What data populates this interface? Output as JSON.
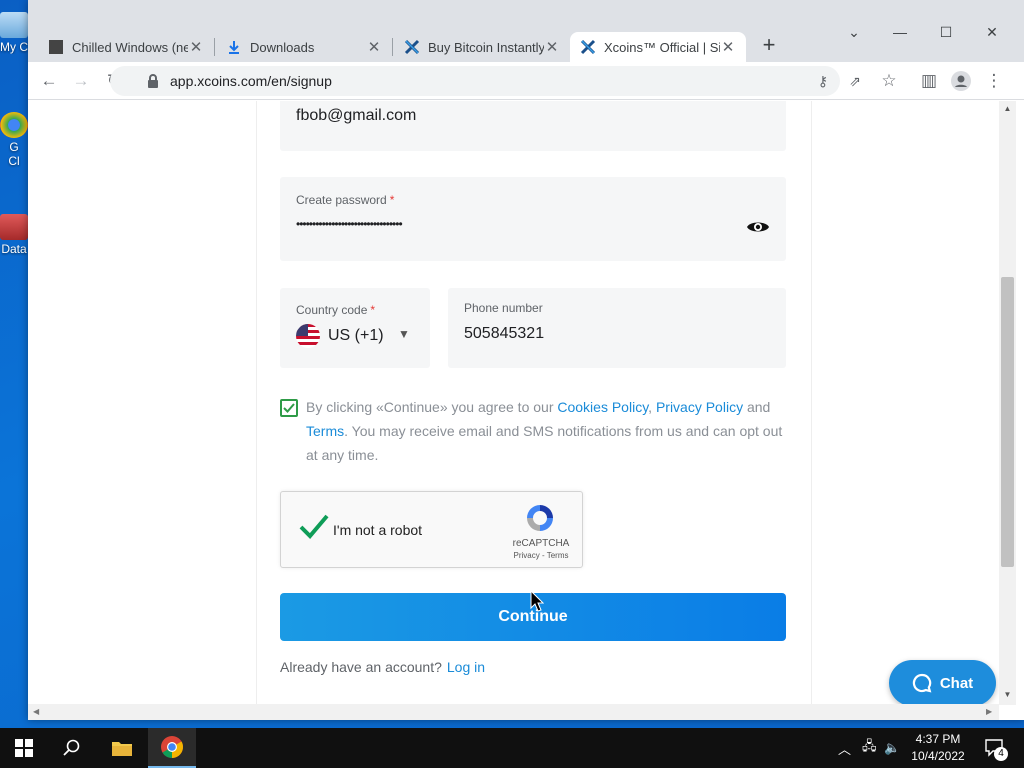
{
  "desktop": {
    "icons": [
      {
        "label": "My C"
      },
      {
        "label": "G"
      },
      {
        "label": "Cl"
      },
      {
        "label": "Data"
      }
    ]
  },
  "browser": {
    "tabs": [
      {
        "title": "Chilled Windows (new",
        "favicon": "video-favicon"
      },
      {
        "title": "Downloads",
        "favicon": "download-icon"
      },
      {
        "title": "Buy Bitcoin Instantly",
        "favicon": "xcoins-logo"
      },
      {
        "title": "Xcoins™ Official | Sig",
        "favicon": "xcoins-logo",
        "active": true
      }
    ],
    "new_tab": "+",
    "url": "app.xcoins.com/en/signup"
  },
  "form": {
    "email_value": "fbob@gmail.com",
    "password_label": "Create password",
    "password_value": "•••••••••••••••••••••••••••••••••",
    "required_mark": "*",
    "country_label": "Country code",
    "country_value": "US (+1)",
    "phone_label": "Phone number",
    "phone_value": "505845321",
    "consent": {
      "prefix": "By clicking «Continue» you agree to our ",
      "cookies": "Cookies Policy",
      "comma": ", ",
      "privacy": "Privacy Policy",
      "and": " and ",
      "terms": "Terms",
      "suffix": ". You may receive email and SMS notifications from us and can opt out at any time.",
      "checked": true
    },
    "captcha": {
      "label": "I'm not a robot",
      "brand": "reCAPTCHA",
      "links": "Privacy - Terms",
      "checked": true
    },
    "continue_label": "Continue",
    "login_prompt": "Already have an account?",
    "login_link": "Log in"
  },
  "chat": {
    "label": "Chat"
  },
  "taskbar": {
    "time": "4:37 PM",
    "date": "10/4/2022",
    "notifications": "4"
  },
  "colors": {
    "accent": "#1a8bd8",
    "button": "#0a7de6",
    "check_green": "#2e9b47",
    "required_red": "#e53935"
  }
}
